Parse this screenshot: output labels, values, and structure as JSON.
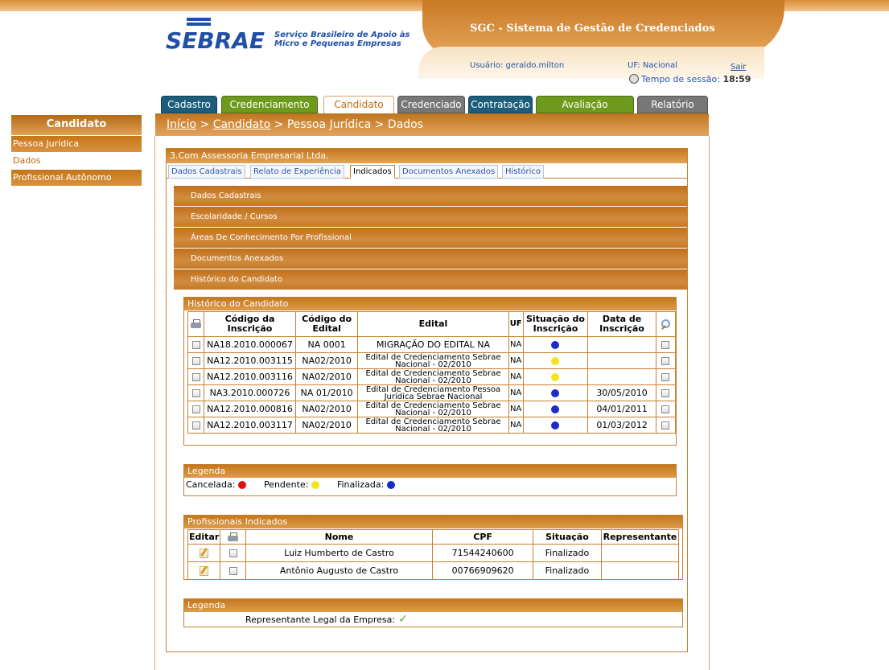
{
  "header": {
    "logo_text": "SEBRAE",
    "logo_subtitle": "Serviço Brasileiro de Apoio às Micro e Pequenas Empresas",
    "system_title": "SGC - Sistema de Gestão de Credenciados",
    "user_label": "Usuário: geraldo.milton",
    "uf_label": "UF: Nacional",
    "logout": "Sair",
    "session_label": "Tempo de sessão:",
    "session_time": "18:59"
  },
  "main_tabs": [
    {
      "label": "Cadastro",
      "color": "#1c5d7c"
    },
    {
      "label": "Credenciamento",
      "color": "#6d9a1c"
    },
    {
      "label": "Candidato",
      "color": "#ffffff"
    },
    {
      "label": "Credenciado",
      "color": "#777777"
    },
    {
      "label": "Contratação",
      "color": "#1c5d7c"
    },
    {
      "label": "Avaliação",
      "color": "#6d9a1c"
    },
    {
      "label": "Relatório",
      "color": "#777777"
    }
  ],
  "sidebar": {
    "title": "Candidato",
    "items": [
      {
        "label": "Pessoa Jurídica"
      },
      {
        "label": "Dados"
      },
      {
        "label": "Profissional Autônomo"
      }
    ]
  },
  "breadcrumb": {
    "home": "Início",
    "sep1": " > ",
    "candidato": "Candidato",
    "rest": " > Pessoa Jurídica > Dados"
  },
  "company": {
    "title": "3.Com Assessoria Empresarial Ltda.",
    "tabs": [
      "Dados Cadastrais",
      "Relato de Experiência",
      "Indicados",
      "Documentos Anexados",
      "Histórico"
    ],
    "active_tab": "Indicados"
  },
  "accordion": [
    "Dados Cadastrais",
    "Escolaridade / Cursos",
    "Áreas De Conhecimento Por Profissional",
    "Documentos Anexados",
    "Histórico do Candidato"
  ],
  "history": {
    "title": "Histórico do Candidato",
    "headers": {
      "codigo_inscricao": "Código da Inscrição",
      "codigo_edital": "Código do Edital",
      "edital": "Edital",
      "uf": "UF",
      "situacao": "Situação do Inscrição",
      "data": "Data de Inscrição"
    },
    "rows": [
      {
        "inscricao": "NA18.2010.000067",
        "edital_code": "NA 0001",
        "edital": "MIGRAÇÃO DO EDITAL NA",
        "uf": "NA",
        "status": "blue",
        "data": ""
      },
      {
        "inscricao": "NA12.2010.003115",
        "edital_code": "NA02/2010",
        "edital": "Edital de Credenciamento Sebrae Nacional - 02/2010",
        "uf": "NA",
        "status": "yellow",
        "data": ""
      },
      {
        "inscricao": "NA12.2010.003116",
        "edital_code": "NA02/2010",
        "edital": "Edital de Credenciamento Sebrae Nacional - 02/2010",
        "uf": "NA",
        "status": "yellow",
        "data": ""
      },
      {
        "inscricao": "NA3.2010.000726",
        "edital_code": "NA 01/2010",
        "edital": "Edital de Credenciamento Pessoa Jurídica Sebrae Nacional",
        "uf": "NA",
        "status": "blue",
        "data": "30/05/2010"
      },
      {
        "inscricao": "NA12.2010.000816",
        "edital_code": "NA02/2010",
        "edital": "Edital de Credenciamento Sebrae Nacional - 02/2010",
        "uf": "NA",
        "status": "blue",
        "data": "04/01/2011"
      },
      {
        "inscricao": "NA12.2010.003117",
        "edital_code": "NA02/2010",
        "edital": "Edital de Credenciamento Sebrae Nacional - 02/2010",
        "uf": "NA",
        "status": "blue",
        "data": "01/03/2012"
      }
    ]
  },
  "status_colors": {
    "red": "#e01010",
    "yellow": "#f2e41a",
    "blue": "#1a2ccc"
  },
  "legend1": {
    "title": "Legenda",
    "cancelada": "Cancelada:",
    "pendente": "Pendente:",
    "finalizada": "Finalizada:"
  },
  "professionals": {
    "title": "Profissionais Indicados",
    "headers": {
      "editar": "Editar",
      "nome": "Nome",
      "cpf": "CPF",
      "situacao": "Situação",
      "representante": "Representante"
    },
    "rows": [
      {
        "nome": "Luiz Humberto de Castro",
        "cpf": "71544240600",
        "situacao": "Finalizado",
        "representante": ""
      },
      {
        "nome": "Antônio Augusto de Castro",
        "cpf": "00766909620",
        "situacao": "Finalizado",
        "representante": ""
      }
    ]
  },
  "legend2": {
    "title": "Legenda",
    "representante": "Representante Legal da Empresa:"
  }
}
